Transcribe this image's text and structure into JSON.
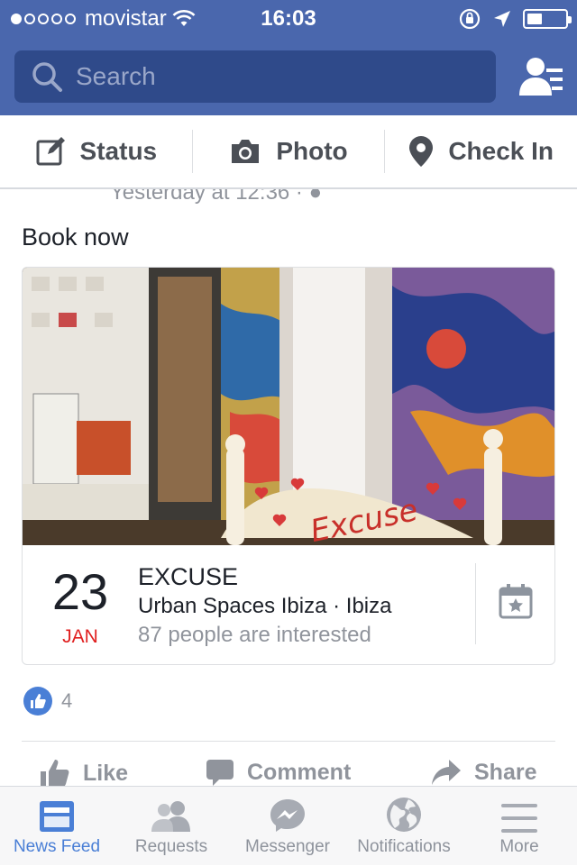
{
  "status_bar": {
    "carrier": "movistar",
    "time": "16:03",
    "battery_level": 0.4
  },
  "search": {
    "placeholder": "Search"
  },
  "composer": {
    "status": "Status",
    "photo": "Photo",
    "check_in": "Check In"
  },
  "post": {
    "timestamp": "Yesterday at 12:36 ·",
    "text": "Book now",
    "event": {
      "photo_text": "Excuse",
      "day": "23",
      "month": "JAN",
      "title": "EXCUSE",
      "location": "Urban Spaces Ibiza · Ibiza",
      "interested": "87 people are interested"
    },
    "like_count": "4",
    "actions": {
      "like": "Like",
      "comment": "Comment",
      "share": "Share"
    }
  },
  "tabs": [
    {
      "label": "News Feed",
      "icon": "news-feed-icon",
      "active": true
    },
    {
      "label": "Requests",
      "icon": "requests-icon"
    },
    {
      "label": "Messenger",
      "icon": "messenger-icon"
    },
    {
      "label": "Notifications",
      "icon": "globe-icon"
    },
    {
      "label": "More",
      "icon": "menu-icon"
    }
  ],
  "colors": {
    "brand": "#4a67ad",
    "accent": "#4a7fd6",
    "date_month": "#e02020"
  }
}
